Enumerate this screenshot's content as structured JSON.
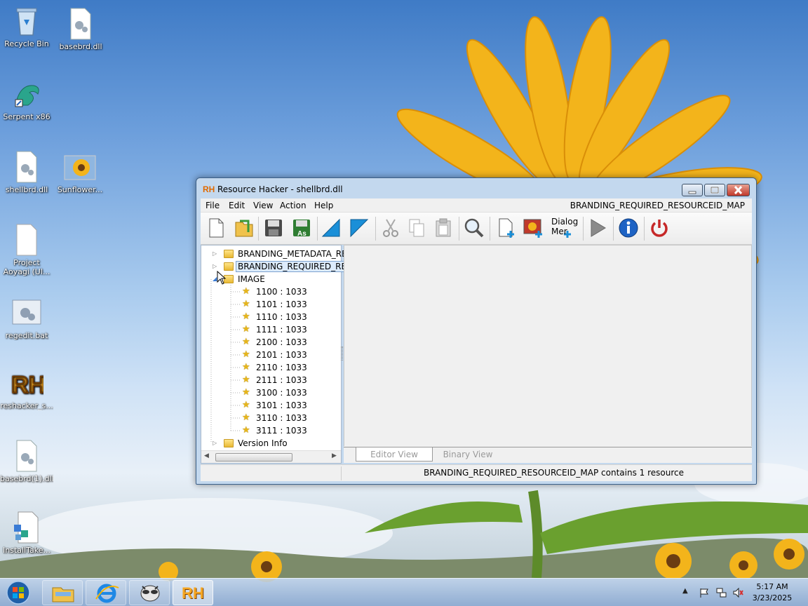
{
  "desktop": {
    "icons": [
      {
        "label": "Recycle Bin"
      },
      {
        "label": "basebrd.dll"
      },
      {
        "label": "Serpent x86"
      },
      {
        "label": "shellbrd.dll"
      },
      {
        "label": "Sunflower..."
      },
      {
        "label": "Project",
        "label2": "Aoyagi (Ul..."
      },
      {
        "label": "regedit.bat"
      },
      {
        "label": "reshacker_s..."
      },
      {
        "label": "basebrd(1).dll"
      },
      {
        "label": "InstallTake..."
      }
    ]
  },
  "window": {
    "logo": "RH",
    "title": "Resource Hacker - shellbrd.dll",
    "menu": [
      "File",
      "Edit",
      "View",
      "Action",
      "Help"
    ],
    "menu_right": "BRANDING_REQUIRED_RESOURCEID_MAP",
    "toolbar": {
      "dialog_label": "Dialog",
      "dialog_label2": "Mer"
    },
    "tree": {
      "items": [
        "BRANDING_METADATA_RE",
        "BRANDING_REQUIRED_RES",
        "IMAGE",
        "Version Info"
      ],
      "image_children": [
        "1100 : 1033",
        "1101 : 1033",
        "1110 : 1033",
        "1111 : 1033",
        "2100 : 1033",
        "2101 : 1033",
        "2110 : 1033",
        "2111 : 1033",
        "3100 : 1033",
        "3101 : 1033",
        "3110 : 1033",
        "3111 : 1033"
      ]
    },
    "tabs": [
      "Editor View",
      "Binary View"
    ],
    "status": "BRANDING_REQUIRED_RESOURCEID_MAP contains 1 resource"
  },
  "taskbar": {
    "time": "5:17 AM",
    "date": "3/23/2025",
    "rh_label": "RH"
  },
  "colors": {
    "accent": "#3a5f88",
    "selection": "#dcebfc",
    "close": "#c0392b"
  }
}
